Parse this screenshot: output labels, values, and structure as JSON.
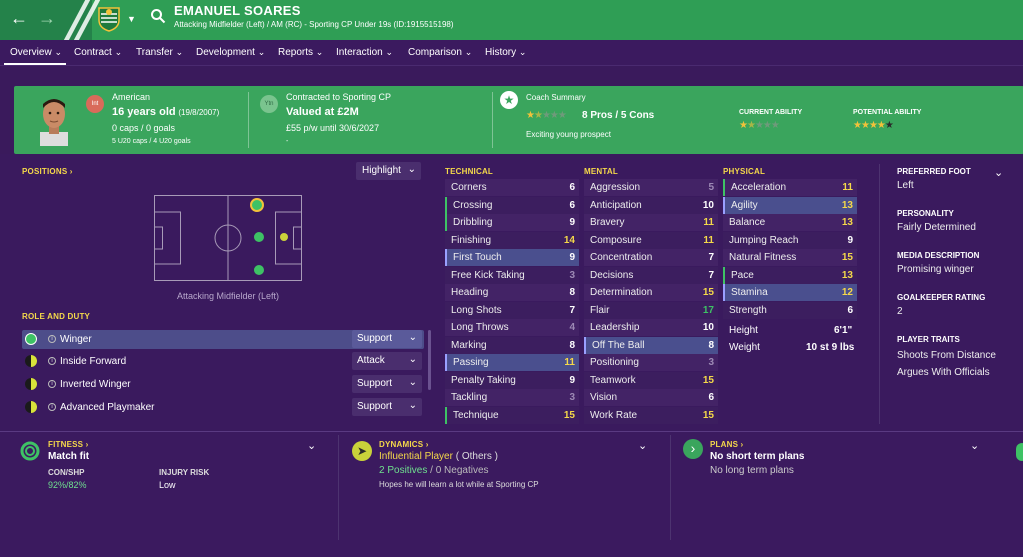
{
  "header": {
    "name": "EMANUEL SOARES",
    "subtitle": "Attacking Midfielder (Left) / AM (RC) - Sporting CP Under 19s (ID:1915515198)",
    "colors": {
      "bar": "#2f9e55",
      "accent": "#f5d94a"
    }
  },
  "nav": [
    {
      "label": "Overview"
    },
    {
      "label": "Contract"
    },
    {
      "label": "Transfer"
    },
    {
      "label": "Development"
    },
    {
      "label": "Reports"
    },
    {
      "label": "Interaction"
    },
    {
      "label": "Comparison"
    },
    {
      "label": "History"
    }
  ],
  "summary": {
    "nationality": "American",
    "age": "16 years old",
    "dob": "(19/8/2007)",
    "caps": "0 caps / 0 goals",
    "u20": "5 U20 caps / 4 U20 goals",
    "int_badge": "Int",
    "ytn_badge": "Ytn",
    "contract_title": "Contracted to Sporting CP",
    "value": "Valued at £2M",
    "wage": "£55 p/w until 30/6/2027",
    "wage_extra": "-",
    "coach_title": "Coach Summary",
    "pros_cons": "8 Pros / 5 Cons",
    "coach_note": "Exciting young prospect",
    "coach_stars": 1.5,
    "current_ability_label": "CURRENT ABILITY",
    "current_ability_stars": 1.5,
    "potential_ability_label": "POTENTIAL ABILITY",
    "potential_ability_stars": 4.5
  },
  "positions": {
    "title": "POSITIONS ›",
    "highlight": "Highlight",
    "caption": "Attacking Midfielder (Left)"
  },
  "roles": {
    "title": "ROLE AND DUTY",
    "items": [
      {
        "name": "Winger",
        "duty": "Support"
      },
      {
        "name": "Inside Forward",
        "duty": "Attack"
      },
      {
        "name": "Inverted Winger",
        "duty": "Support"
      },
      {
        "name": "Advanced Playmaker",
        "duty": "Support"
      }
    ]
  },
  "technical": {
    "title": "TECHNICAL",
    "items": [
      {
        "name": "Corners",
        "value": "6"
      },
      {
        "name": "Crossing",
        "value": "6"
      },
      {
        "name": "Dribbling",
        "value": "9"
      },
      {
        "name": "Finishing",
        "value": "14"
      },
      {
        "name": "First Touch",
        "value": "9"
      },
      {
        "name": "Free Kick Taking",
        "value": "3"
      },
      {
        "name": "Heading",
        "value": "8"
      },
      {
        "name": "Long Shots",
        "value": "7"
      },
      {
        "name": "Long Throws",
        "value": "4"
      },
      {
        "name": "Marking",
        "value": "8"
      },
      {
        "name": "Passing",
        "value": "11"
      },
      {
        "name": "Penalty Taking",
        "value": "9"
      },
      {
        "name": "Tackling",
        "value": "3"
      },
      {
        "name": "Technique",
        "value": "15"
      }
    ]
  },
  "mental": {
    "title": "MENTAL",
    "items": [
      {
        "name": "Aggression",
        "value": "5"
      },
      {
        "name": "Anticipation",
        "value": "10"
      },
      {
        "name": "Bravery",
        "value": "11"
      },
      {
        "name": "Composure",
        "value": "11"
      },
      {
        "name": "Concentration",
        "value": "7"
      },
      {
        "name": "Decisions",
        "value": "7"
      },
      {
        "name": "Determination",
        "value": "15"
      },
      {
        "name": "Flair",
        "value": "17"
      },
      {
        "name": "Leadership",
        "value": "10"
      },
      {
        "name": "Off The Ball",
        "value": "8"
      },
      {
        "name": "Positioning",
        "value": "3"
      },
      {
        "name": "Teamwork",
        "value": "15"
      },
      {
        "name": "Vision",
        "value": "6"
      },
      {
        "name": "Work Rate",
        "value": "15"
      }
    ]
  },
  "physical": {
    "title": "PHYSICAL",
    "items": [
      {
        "name": "Acceleration",
        "value": "11"
      },
      {
        "name": "Agility",
        "value": "13"
      },
      {
        "name": "Balance",
        "value": "13"
      },
      {
        "name": "Jumping Reach",
        "value": "9"
      },
      {
        "name": "Natural Fitness",
        "value": "15"
      },
      {
        "name": "Pace",
        "value": "13"
      },
      {
        "name": "Stamina",
        "value": "12"
      },
      {
        "name": "Strength",
        "value": "6"
      }
    ],
    "height_label": "Height",
    "height": "6'1\"",
    "weight_label": "Weight",
    "weight": "10 st 9 lbs"
  },
  "side": {
    "foot_label": "PREFERRED FOOT",
    "foot": "Left",
    "personality_label": "PERSONALITY",
    "personality": "Fairly Determined",
    "media_label": "MEDIA DESCRIPTION",
    "media": "Promising winger",
    "gk_label": "GOALKEEPER RATING",
    "gk": "2",
    "traits_label": "PLAYER TRAITS",
    "traits": [
      "Shoots From Distance",
      "Argues With Officials"
    ]
  },
  "bottom": {
    "fitness_title": "FITNESS ›",
    "fitness": "Match fit",
    "conshp_label": "CON/SHP",
    "con": "92%",
    "shp": "82%",
    "injury_label": "INJURY RISK",
    "injury": "Low",
    "dynamics_title": "DYNAMICS ›",
    "dynamics_player": "Influential Player",
    "dynamics_group": "( Others )",
    "positives": "2 Positives",
    "negatives": "0 Negatives",
    "dynamics_note": "Hopes he will learn a lot while at Sporting CP",
    "plans_title": "PLANS ›",
    "plans": "No short term plans",
    "plans2": "No long term plans"
  }
}
